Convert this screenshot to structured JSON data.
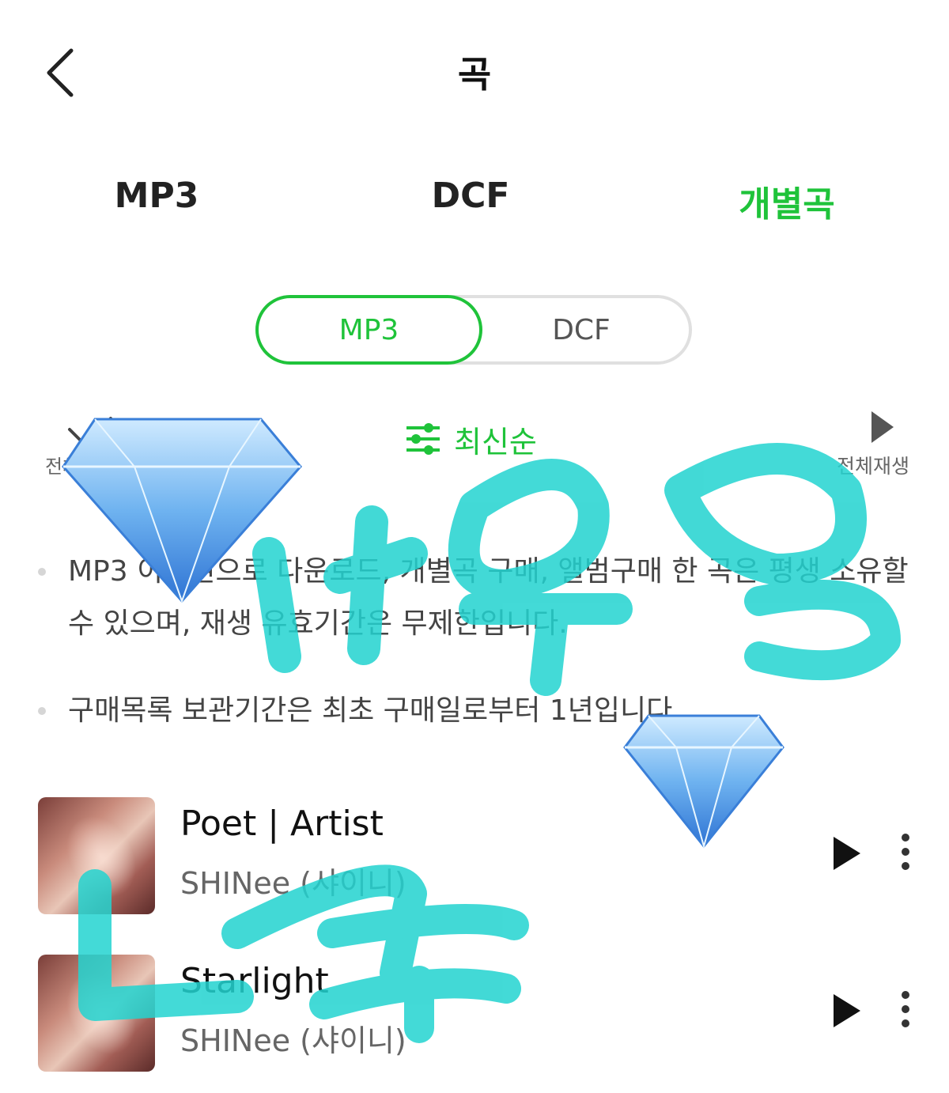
{
  "header": {
    "title": "곡",
    "back_icon": "chevron-left-icon"
  },
  "category_tabs": [
    {
      "label": "MP3",
      "active": false
    },
    {
      "label": "DCF",
      "active": false
    },
    {
      "label": "개별곡",
      "active": true
    }
  ],
  "format_toggle": {
    "options": [
      "MP3",
      "DCF"
    ],
    "selected": "MP3"
  },
  "toolbar": {
    "select_all_label": "전체",
    "sort_label": "최신순",
    "play_all_label": "전체재생"
  },
  "notices": [
    "MP3 이용권으로 다운로드, 개별곡 구매, 앨범구매 한 곡은 평생 소유할 수 있으며, 재생 유효기간은 무제한입니다.",
    "구매목록 보관기간은 최초 구매일로부터 1년입니다."
  ],
  "songs": [
    {
      "title": "Poet | Artist",
      "artist": "SHINee (샤이니)"
    },
    {
      "title": "Starlight",
      "artist": "SHINee (샤이니)"
    }
  ],
  "colors": {
    "accent": "#1fc33a",
    "toggle_border": "#e0e0e0",
    "overlay_marker": "#22d3d0"
  }
}
